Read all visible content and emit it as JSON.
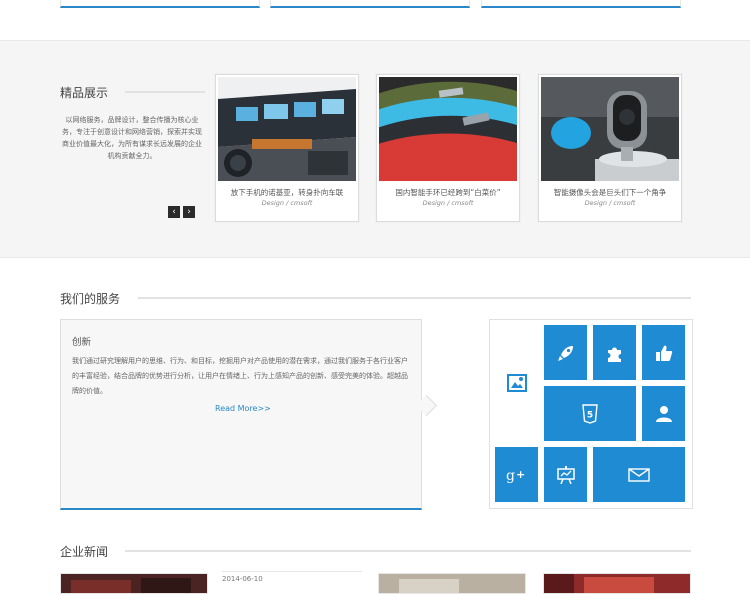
{
  "products": {
    "title": "精品展示",
    "intro": "以网络服务，品牌设计，整合传播为核心业务，专注于创意设计和网络营销，探索并实现商业价值最大化，为所有谋求长远发展的企业机构贡献全力。",
    "prev_label": "‹",
    "next_label": "›",
    "items": [
      {
        "title": "放下手机的诺基亚，转身扑向车联",
        "sub": "Design / cmsoft"
      },
      {
        "title": "国内智能手环已经跨到“白菜价”",
        "sub": "Design / cmsoft"
      },
      {
        "title": "智能摄像头会是巨头们下一个角争",
        "sub": "Design / cmsoft"
      }
    ]
  },
  "services": {
    "title": "我们的服务",
    "heading": "创新",
    "text": "我们通过研究理解用户的思维、行为、和目标，挖掘用户对产品使用的潜在需求，通过我们服务于各行业客户的丰富经验，结合品牌的优势进行分析，让用户在情绪上、行为上感知产品的创新、感受完美的体验。超越品牌的价值。",
    "more": "Read More>>",
    "tiles": [
      "image-icon",
      "rocket-icon",
      "puzzle-icon",
      "thumbs-up-icon",
      "html5-icon",
      "user-icon",
      "google-plus-icon",
      "presentation-icon",
      "mail-icon"
    ]
  },
  "news": {
    "title": "企业新闻",
    "date": "2014-06-10"
  },
  "colors": {
    "accent": "#1f8bd3",
    "band": "#f5f5f5"
  }
}
